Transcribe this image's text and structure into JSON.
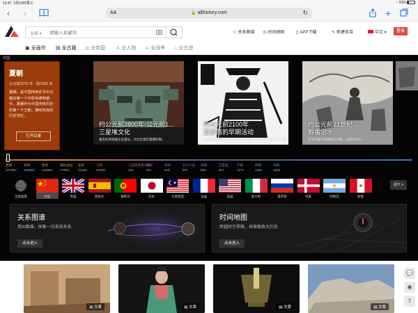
{
  "status_bar": {
    "time": "13:47",
    "date": "2月19日周三",
    "battery": "23%",
    "battery_level": 0.23
  },
  "browser": {
    "aa": "AA",
    "url": "allhistory.com"
  },
  "header": {
    "search_scope": "全部 ▾",
    "search_placeholder": "请输入关键词",
    "nav": [
      {
        "label": "关系图谱"
      },
      {
        "label": "时间地图"
      },
      {
        "label": "APP下载"
      },
      {
        "label": "新建条目"
      },
      {
        "label": "中文 ▾"
      }
    ],
    "login": "登录"
  },
  "categories": [
    {
      "label": "全画作",
      "active": true
    },
    {
      "label": "全古籍",
      "active": true
    },
    {
      "label": "全帝国",
      "active": false
    },
    {
      "label": "全人物",
      "active": false
    },
    {
      "label": "全战争",
      "active": false
    },
    {
      "label": "全古迹",
      "active": false
    }
  ],
  "region_label": "中国",
  "feature": {
    "title": "夏朝",
    "dates": "公元前2070 年 - 前1600 年",
    "body": "夏朝，是中国传统史书中记载的第一个中原世袭制朝代，夏朝作为中国传统历史的第一个王朝，拥有较高的历史地位。",
    "button": "打开目录"
  },
  "cards": [
    {
      "title": "约公元前2800年-公元前1...",
      "subtitle": "三星堆文化",
      "desc": "著名的青铜器文化遗址，大约出现在夏朝时期。"
    },
    {
      "title": "约公元前2100年",
      "subtitle": "夏部落的早期活动",
      "desc": "夏部落是夏朝的前身，在与其他部落，也开始了在黄河流域的活动。"
    },
    {
      "title": "约公元前21世纪",
      "subtitle": "鲧禹治水",
      "desc": "史书记载大禹接替父亲鲧，以疏导为主..."
    }
  ],
  "timeline": [
    {
      "name": "夏朝",
      "year": "2070BC",
      "color": "#e07a3a"
    },
    {
      "name": "商朝",
      "year": "1600BC",
      "color": "#e07a3a"
    },
    {
      "name": "西周",
      "year": "1046BC",
      "color": "#d9893f"
    },
    {
      "name": "春秋战国",
      "year": "770BC",
      "color": "#c0903e"
    },
    {
      "name": "秦朝",
      "year": "221BC",
      "color": "#c46a4a"
    },
    {
      "name": "汉朝",
      "year": "202BC",
      "color": "#c05a4a"
    },
    {
      "name": "三国两晋南北朝",
      "year": "184",
      "color": "#a85a8a"
    },
    {
      "name": "隋朝",
      "year": "581",
      "color": "#7a5aa8"
    },
    {
      "name": "唐朝",
      "year": "618",
      "color": "#6a6ab8"
    },
    {
      "name": "五代十国",
      "year": "907",
      "color": "#5a7ac0"
    },
    {
      "name": "宋朝",
      "year": "960",
      "color": "#4a86d0"
    },
    {
      "name": "辽夏金",
      "year": "907",
      "color": "#4a86d0"
    },
    {
      "name": "元朝",
      "year": "1271",
      "color": "#4a86d0"
    },
    {
      "name": "明朝",
      "year": "1368",
      "color": "#4a86d0"
    },
    {
      "name": "清朝",
      "year": "1636",
      "color": "#4a86d0"
    }
  ],
  "flags": [
    {
      "label": "全部国家",
      "icon": "globe-icon"
    },
    {
      "label": "中国",
      "icon": "flag-china-icon",
      "selected": true
    },
    {
      "label": "英国",
      "icon": "flag-uk-icon"
    },
    {
      "label": "西班牙",
      "icon": "flag-spain-icon"
    },
    {
      "label": "葡萄牙",
      "icon": "flag-portugal-icon"
    },
    {
      "label": "日本",
      "icon": "flag-japan-icon"
    },
    {
      "label": "马来西亚",
      "icon": "flag-malaysia-icon"
    },
    {
      "label": "法国",
      "icon": "flag-france-icon"
    },
    {
      "label": "美国",
      "icon": "flag-usa-icon"
    },
    {
      "label": "意大利",
      "icon": "flag-italy-icon"
    },
    {
      "label": "俄罗斯",
      "icon": "flag-russia-icon"
    },
    {
      "label": "丹麦",
      "icon": "flag-denmark-icon"
    },
    {
      "label": "阿根廷",
      "icon": "flag-argentina-icon"
    },
    {
      "label": "秘鲁",
      "icon": "flag-peru-icon"
    }
  ],
  "expand_label": "展开 ▾",
  "panels": [
    {
      "title": "关系图谱",
      "desc": "用AI图谱，探索一切未知关系",
      "button": "点击进入"
    },
    {
      "title": "时间地图",
      "desc": "跨越时空界限，探索极致大历史",
      "button": "点击进入"
    }
  ],
  "articles": [
    {
      "tag": "文章"
    },
    {
      "tag": "文章"
    },
    {
      "tag": "文章"
    },
    {
      "tag": "文章"
    }
  ],
  "colors": {
    "accent": "#e04a3f",
    "feature_bg": "#9b3c0a",
    "dark_bg": "#050505"
  }
}
